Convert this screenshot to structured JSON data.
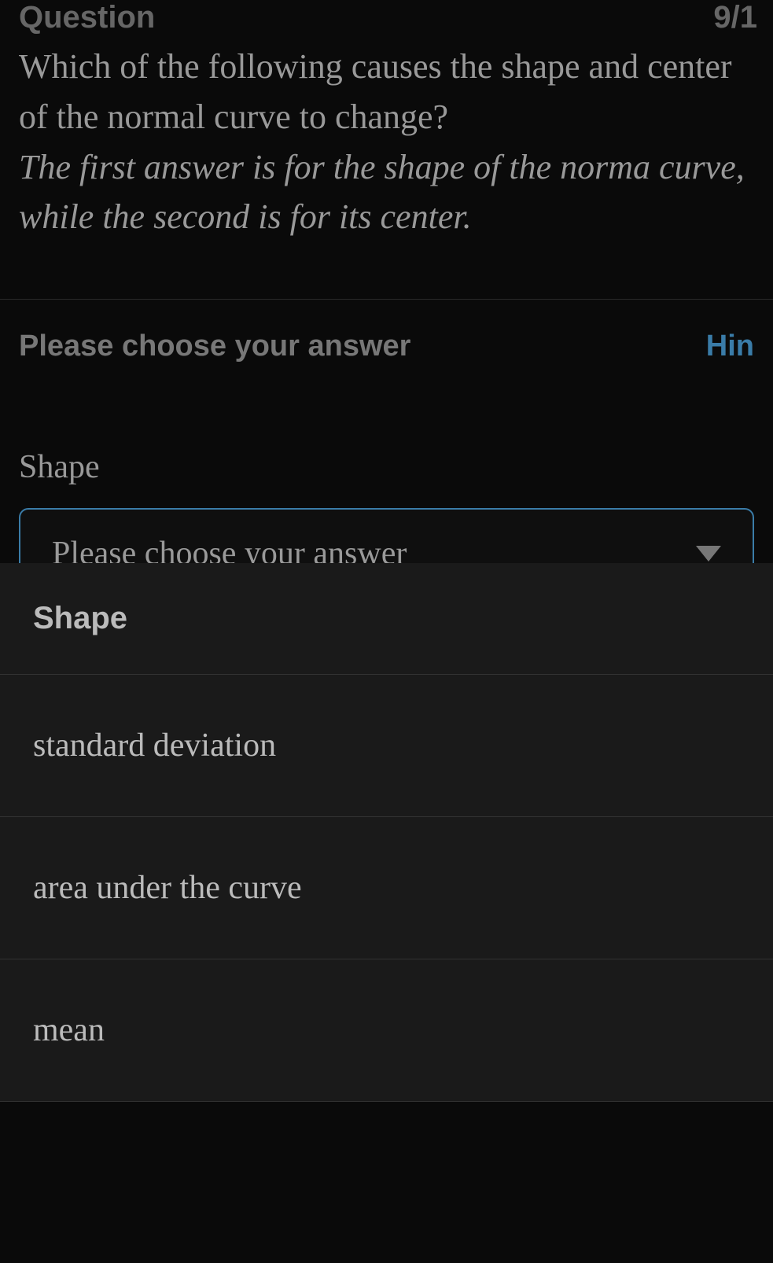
{
  "header": {
    "question_label": "Question",
    "counter": "9/1",
    "question_text": "Which of the following causes the shape and center of the normal curve to change?",
    "question_hint": "The first answer is for the shape of the norma curve, while the second is for its center."
  },
  "answer": {
    "prompt": "Please choose your answer",
    "hint_link": "Hin",
    "field_label": "Shape",
    "dropdown_placeholder": "Please choose your answer"
  },
  "options": {
    "header": "Shape",
    "items": [
      "standard deviation",
      "area under the curve",
      "mean"
    ]
  }
}
